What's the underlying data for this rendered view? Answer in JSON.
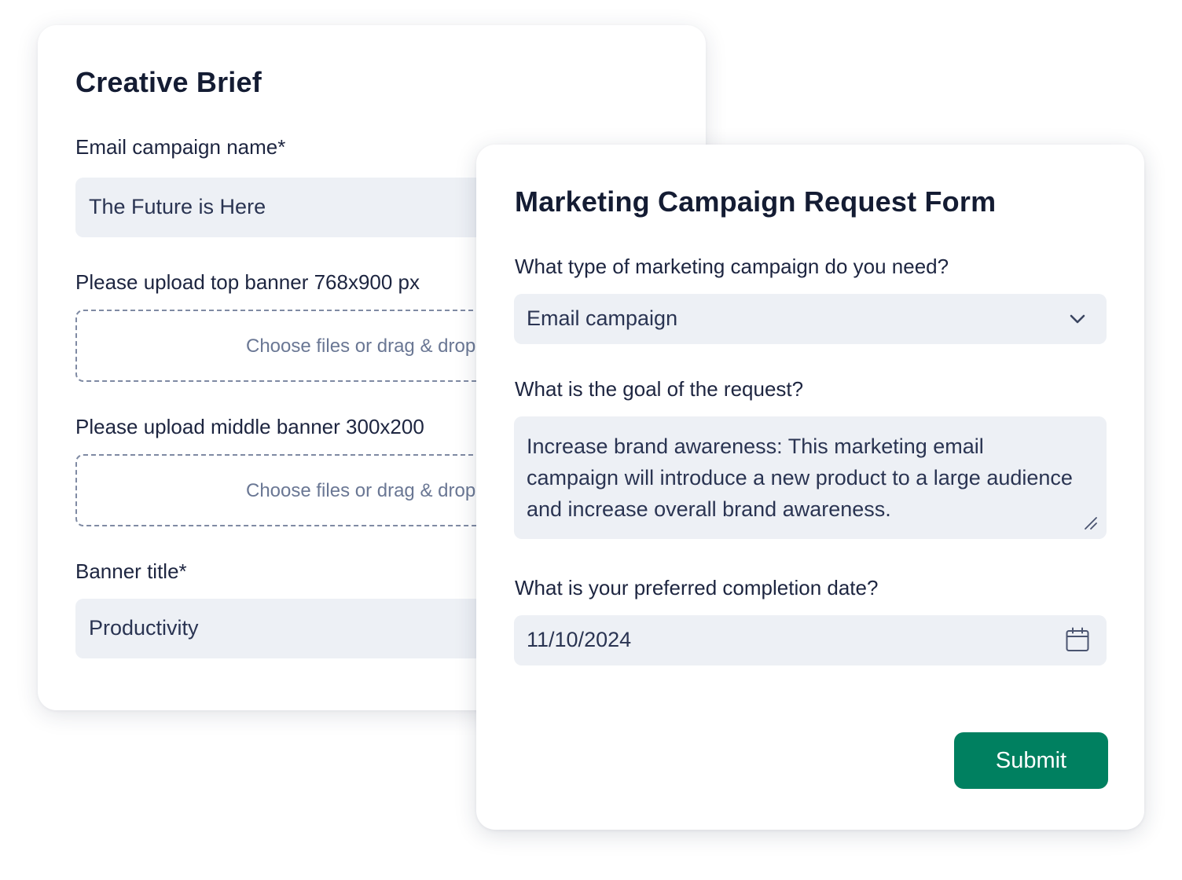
{
  "creative_brief": {
    "title": "Creative Brief",
    "campaign_name": {
      "label": "Email campaign name*",
      "value": "The Future is Here"
    },
    "top_banner_upload": {
      "label": "Please upload top banner 768x900 px",
      "dropzone_text": "Choose files or drag & drop"
    },
    "middle_banner_upload": {
      "label": "Please upload middle banner 300x200",
      "dropzone_text": "Choose files or drag & drop"
    },
    "banner_title": {
      "label": "Banner title*",
      "value": "Productivity"
    }
  },
  "request_form": {
    "title": "Marketing Campaign Request Form",
    "campaign_type": {
      "label": "What type of marketing campaign do you need?",
      "value": "Email campaign",
      "icon": "chevron-down-icon"
    },
    "goal": {
      "label": "What is the goal of the request?",
      "value": "Increase brand awareness: This marketing email campaign will introduce a new product to a large audience and increase overall brand awareness."
    },
    "completion_date": {
      "label": "What is your preferred completion date?",
      "value": "11/10/2024",
      "icon": "calendar-icon"
    },
    "submit_label": "Submit"
  },
  "colors": {
    "primary_button": "#008060",
    "field_background": "#edf0f5",
    "heading_text": "#141c33"
  }
}
